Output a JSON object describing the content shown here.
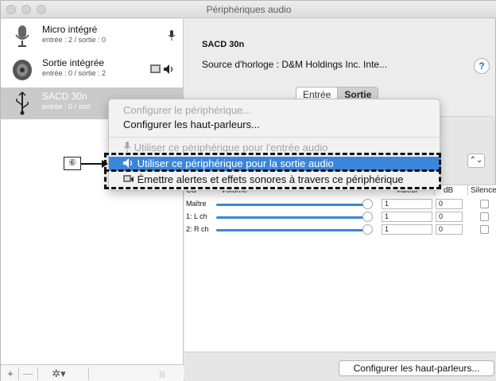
{
  "window": {
    "title": "Périphériques audio"
  },
  "sidebar": {
    "devices": [
      {
        "name": "Micro intégré",
        "sub": "entrée : 2 / sortie : 0",
        "icon": "microphone-icon",
        "right_icon": "microphone-small-icon",
        "selected": false
      },
      {
        "name": "Sortie intégrée",
        "sub": "entrée : 0 / sortie : 2",
        "icon": "speaker-icon",
        "right_icon": "speaker-output-icon",
        "selected": false
      },
      {
        "name": "SACD 30n",
        "sub": "entrée : 0 / sort",
        "icon": "usb-icon",
        "selected": true
      }
    ],
    "footer": {
      "add": "+",
      "remove": "—",
      "gear": "✲▾"
    }
  },
  "main": {
    "device_title": "SACD 30n",
    "clock_source": "Source d'horloge :  D&M Holdings Inc. Inte...",
    "help": "?",
    "tabs": [
      {
        "label": "Entrée",
        "active": false
      },
      {
        "label": "Sortie",
        "active": true
      }
    ],
    "table": {
      "headers": {
        "ch": "Ca",
        "volume": "Volume",
        "value": "Valeur",
        "db": "dB",
        "mute": "Silence"
      },
      "rows": [
        {
          "label": "Maître",
          "value": "1",
          "db": "0",
          "level": 1.0
        },
        {
          "label": "1: L ch",
          "value": "1",
          "db": "0",
          "level": 1.0
        },
        {
          "label": "2: R ch",
          "value": "1",
          "db": "0",
          "level": 1.0
        }
      ]
    },
    "configure_speakers_button": "Configurer les haut-parleurs..."
  },
  "context_menu": {
    "items": [
      {
        "label": "Configurer le périphérique...",
        "disabled": true
      },
      {
        "label": "Configurer les haut-parleurs...",
        "disabled": false
      },
      {
        "label": "Utiliser ce périphérique pour l'entrée audio",
        "disabled": true,
        "icon": "microphone-icon"
      },
      {
        "label": "Utiliser ce périphérique pour la sortie audio",
        "highlighted": true,
        "icon": "speaker-icon"
      },
      {
        "label": "Émettre alertes et effets sonores à travers ce périphérique",
        "disabled": false,
        "icon": "alert-icon"
      }
    ]
  },
  "callout": {
    "label": "⑥"
  },
  "colors": {
    "highlight": "#3b86db",
    "slider": "#3a86d8",
    "selection": "#cacaca"
  }
}
